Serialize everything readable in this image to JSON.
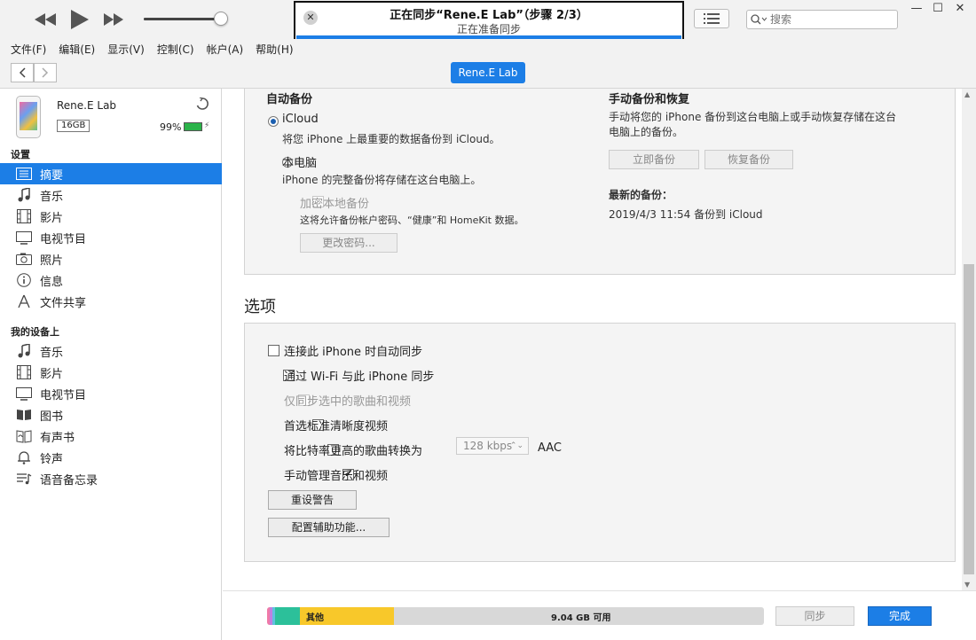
{
  "player": {
    "volume_fraction": 0.93,
    "sync_status": {
      "title": "正在同步“Rene.E Lab”（步骤 2/3）",
      "subtitle": "正在准备同步",
      "progress_fraction": 1.0
    },
    "search_placeholder": "搜索"
  },
  "menu": [
    "文件(F)",
    "编辑(E)",
    "显示(V)",
    "控制(C)",
    "帐户(A)",
    "帮助(H)"
  ],
  "device_pill": "Rene.E Lab",
  "device": {
    "name": "Rene.E Lab",
    "capacity": "16GB",
    "battery_text": "99%",
    "battery_fraction": 0.99
  },
  "sidebar": {
    "settings_header": "设置",
    "settings_items": [
      {
        "label": "摘要",
        "icon": "summary-icon",
        "active": true
      },
      {
        "label": "音乐",
        "icon": "music-note-icon"
      },
      {
        "label": "影片",
        "icon": "film-icon"
      },
      {
        "label": "电视节目",
        "icon": "tv-icon"
      },
      {
        "label": "照片",
        "icon": "camera-icon"
      },
      {
        "label": "信息",
        "icon": "info-icon"
      },
      {
        "label": "文件共享",
        "icon": "file-sharing-icon"
      }
    ],
    "ondevice_header": "我的设备上",
    "ondevice_items": [
      {
        "label": "音乐",
        "icon": "music-note-icon"
      },
      {
        "label": "影片",
        "icon": "film-icon"
      },
      {
        "label": "电视节目",
        "icon": "tv-icon"
      },
      {
        "label": "图书",
        "icon": "book-icon"
      },
      {
        "label": "有声书",
        "icon": "audiobook-icon"
      },
      {
        "label": "铃声",
        "icon": "bell-icon"
      },
      {
        "label": "语音备忘录",
        "icon": "voice-memo-icon"
      }
    ]
  },
  "backup": {
    "auto_title": "自动备份",
    "icloud_label": "iCloud",
    "icloud_desc": "将您 iPhone 上最重要的数据备份到 iCloud。",
    "computer_label": "本电脑",
    "computer_desc": "iPhone 的完整备份将存储在这台电脑上。",
    "encrypt_label": "加密本地备份",
    "encrypt_desc": "这将允许备份帐户密码、“健康”和 HomeKit 数据。",
    "change_password": "更改密码...",
    "manual_title": "手动备份和恢复",
    "manual_desc_1": "手动将您的 iPhone 备份到这台电脑上或手动恢复存储在这台",
    "manual_desc_2": "电脑上的备份。",
    "backup_now": "立即备份",
    "restore_backup": "恢复备份",
    "latest_title": "最新的备份：",
    "latest_value": "2019/4/3 11:54 备份到 iCloud"
  },
  "options": {
    "title": "选项",
    "auto_sync": "连接此 iPhone 时自动同步",
    "wifi_sync": "通过 Wi-Fi 与此 iPhone 同步",
    "checked_only": "仅同步选中的歌曲和视频",
    "prefer_sd": "首选标准清晰度视频",
    "convert_bitrate": "将比特率更高的歌曲转换为",
    "bitrate_value": "128 kbps",
    "bitrate_format": "AAC",
    "manual_manage": "手动管理音乐和视频",
    "reset_warnings": "重设警告",
    "configure_accessibility": "配置辅助功能..."
  },
  "storage": {
    "other_label": "其他",
    "free_label": "9.04 GB 可用",
    "segments": [
      {
        "fraction": 0.006,
        "color": "#f07aa8"
      },
      {
        "fraction": 0.004,
        "color": "#c080e0"
      },
      {
        "fraction": 0.006,
        "color": "#60c0e0"
      },
      {
        "fraction": 0.05,
        "color": "#2cc09a"
      },
      {
        "fraction": 0.19,
        "color": "#f8c82a"
      }
    ]
  },
  "buttons": {
    "sync": "同步",
    "done": "完成"
  },
  "colors": {
    "accent": "#1c7ee6",
    "battery": "#2bb34a"
  }
}
